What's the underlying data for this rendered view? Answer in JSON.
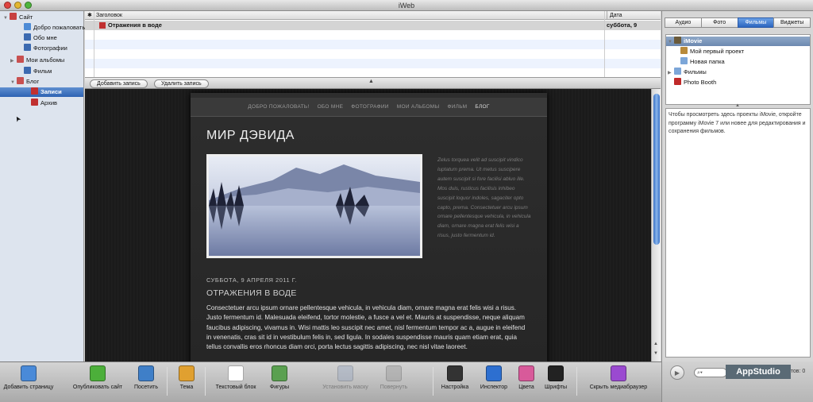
{
  "window": {
    "title": "iWeb"
  },
  "sidebar": {
    "items": [
      {
        "label": "Сайт",
        "indent": 0,
        "tri": "▼",
        "color": "#c74040"
      },
      {
        "label": "Добро пожаловать!",
        "indent": 2,
        "tri": "",
        "color": "#4d8bd6"
      },
      {
        "label": "Обо мне",
        "indent": 2,
        "tri": "",
        "color": "#3c6ab0"
      },
      {
        "label": "Фотографии",
        "indent": 2,
        "tri": "",
        "color": "#3c6ab0"
      },
      {
        "label": "Мои альбомы",
        "indent": 1,
        "tri": "▶",
        "color": "#c85050"
      },
      {
        "label": "Фильм",
        "indent": 2,
        "tri": "",
        "color": "#3c6ab0"
      },
      {
        "label": "Блог",
        "indent": 1,
        "tri": "▼",
        "color": "#c85050"
      },
      {
        "label": "Записи",
        "indent": 3,
        "tri": "",
        "color": "#c03030",
        "selected": true
      },
      {
        "label": "Архив",
        "indent": 3,
        "tri": "",
        "color": "#c03030"
      }
    ]
  },
  "bloglist": {
    "col_title": "Заголовок",
    "col_date": "Дата",
    "entries": [
      {
        "title": "Отражения в воде",
        "date": "суббота, 9"
      }
    ],
    "add_label": "Добавить запись",
    "delete_label": "Удалить запись"
  },
  "site": {
    "nav": [
      "ДОБРО ПОЖАЛОВАТЬ!",
      "ОБО МНЕ",
      "ФОТОГРАФИИ",
      "МОИ АЛЬБОМЫ",
      "ФИЛЬМ",
      "БЛОГ"
    ],
    "title": "МИР ДЭВИДА",
    "side_text": "Zelus torquea velit ad suscipit vindico luptatum prema. Ut metus suscipere autem suscipit si fore facilisi abluo ille. Mos duis, rusticus facilisis inhibeo suscipit loquor indoles, sagaciter opto capto, prema. Consectetuer arcu ipsum ornare pellentesque vehicula, in vehicula diam, ornare magna erat felis wisi a risus, justo fermentum id.",
    "post_date": "СУББОТА, 9 АПРЕЛЯ 2011 Г.",
    "post_title": "ОТРАЖЕНИЯ В ВОДЕ",
    "post_body": "Consectetuer arcu ipsum ornare pellentesque vehicula, in vehicula diam, ornare magna erat felis wisi a risus. Justo fermentum id. Malesuada eleifend, tortor molestie, a fusce a vel et. Mauris at suspendisse, neque aliquam faucibus adipiscing, vivamus in. Wisi mattis leo suscipit nec amet, nisl fermentum tempor ac a, augue in eleifend in venenatis, cras sit id in vestibulum felis in, sed ligula. In sodales suspendisse mauris quam etiam erat, quia tellus convallis eros rhoncus diam orci, porta lectus sagittis adipiscing, nec nisl vitae laoreet."
  },
  "media": {
    "tabs": [
      "Аудио",
      "Фото",
      "Фильмы",
      "Виджеты"
    ],
    "active_tab": 2,
    "tree": [
      {
        "label": "iMovie",
        "indent": 0,
        "tri": "▼",
        "color": "#6a5a3a"
      },
      {
        "label": "Мой первый проект",
        "indent": 1,
        "tri": "",
        "color": "#b88a3a"
      },
      {
        "label": "Новая папка",
        "indent": 1,
        "tri": "",
        "color": "#7ca6d8"
      },
      {
        "label": "Фильмы",
        "indent": 0,
        "tri": "▶",
        "color": "#7ca6d8"
      },
      {
        "label": "Photo Booth",
        "indent": 0,
        "tri": "",
        "color": "#c02a2a"
      }
    ],
    "description": "Чтобы просмотреть здесь проекты iMovie, откройте программу iMovie 7 или новее для редактирования и сохранения фильмов.",
    "search_partial": "атов: 0"
  },
  "toolbar": {
    "items": [
      {
        "label": "Добавить страницу",
        "color": "#4a8ad8",
        "name": "add-page"
      },
      {
        "label": "Опубликовать сайт",
        "color": "#4caf3a",
        "name": "publish-site"
      },
      {
        "label": "Посетить",
        "color": "#3f7fc8",
        "name": "visit"
      },
      {
        "label": "Тема",
        "color": "#e0a030",
        "name": "theme"
      },
      {
        "label": "Текстовый блок",
        "color": "#ffffff",
        "name": "text-box"
      },
      {
        "label": "Фигуры",
        "color": "#5aa050",
        "name": "shapes"
      },
      {
        "label": "Установить маску",
        "color": "#9aa8c0",
        "name": "mask",
        "disabled": true
      },
      {
        "label": "Повернуть",
        "color": "#9a9a9a",
        "name": "rotate",
        "disabled": true
      },
      {
        "label": "Настройка",
        "color": "#333333",
        "name": "adjust"
      },
      {
        "label": "Инспектор",
        "color": "#2d6fd0",
        "name": "inspector"
      },
      {
        "label": "Цвета",
        "color": "#d85a9a",
        "name": "colors"
      },
      {
        "label": "Шрифты",
        "color": "#222222",
        "name": "fonts"
      },
      {
        "label": "Скрыть медиабраузер",
        "color": "#9a4ad0",
        "name": "hide-media-browser"
      }
    ]
  },
  "watermark": "AppStudio"
}
